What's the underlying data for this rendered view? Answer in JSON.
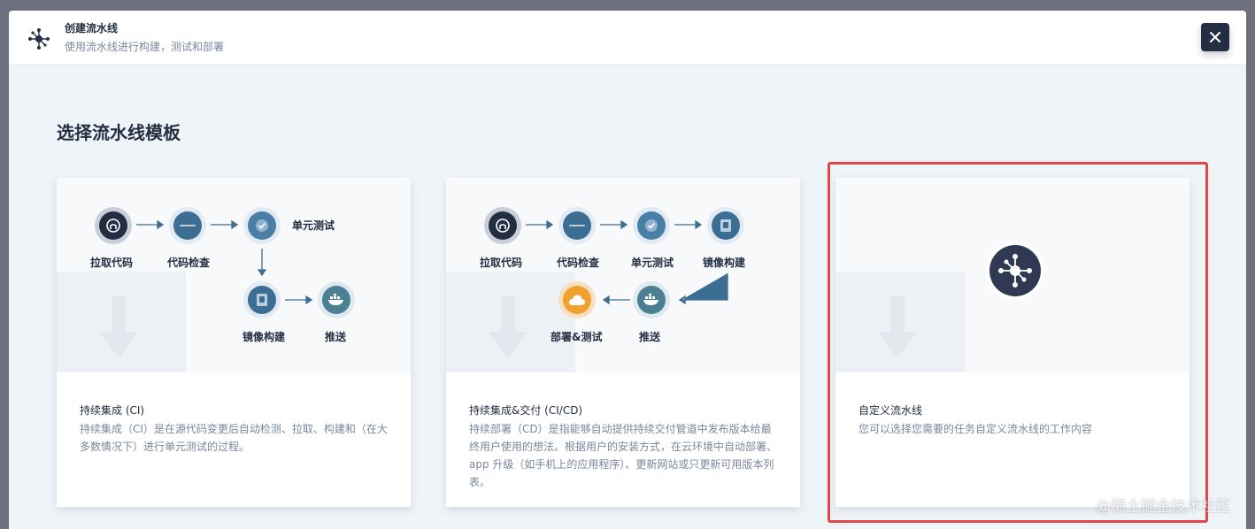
{
  "header": {
    "title": "创建流水线",
    "subtitle": "使用流水线进行构建，测试和部署",
    "icon": "pipeline-icon",
    "close_icon": "close-icon"
  },
  "section_title": "选择流水线模板",
  "cards": [
    {
      "name": "持续集成 (CI)",
      "description": "持续集成（CI）是在源代码变更后自动检测、拉取、构建和（在大多数情况下）进行单元测试的过程。",
      "steps": [
        "拉取代码",
        "代码检查",
        "单元测试",
        "镜像构建",
        "推送"
      ]
    },
    {
      "name": "持续集成&交付 (CI/CD)",
      "description": "持续部署（CD）是指能够自动提供持续交付管道中发布版本给最终用户使用的想法。根据用户的安装方式，在云环境中自动部署、app 升级（如手机上的应用程序）、更新网站或只更新可用版本列表。",
      "steps": [
        "拉取代码",
        "代码检查",
        "单元测试",
        "镜像构建",
        "推送",
        "部署&测试"
      ]
    },
    {
      "name": "自定义流水线",
      "description": "您可以选择您需要的任务自定义流水线的工作内容"
    }
  ],
  "colors": {
    "highlight": "#e04848",
    "dark": "#242e42",
    "blue": "#3c6d93"
  },
  "watermark": "@稀土掘金技术社区"
}
